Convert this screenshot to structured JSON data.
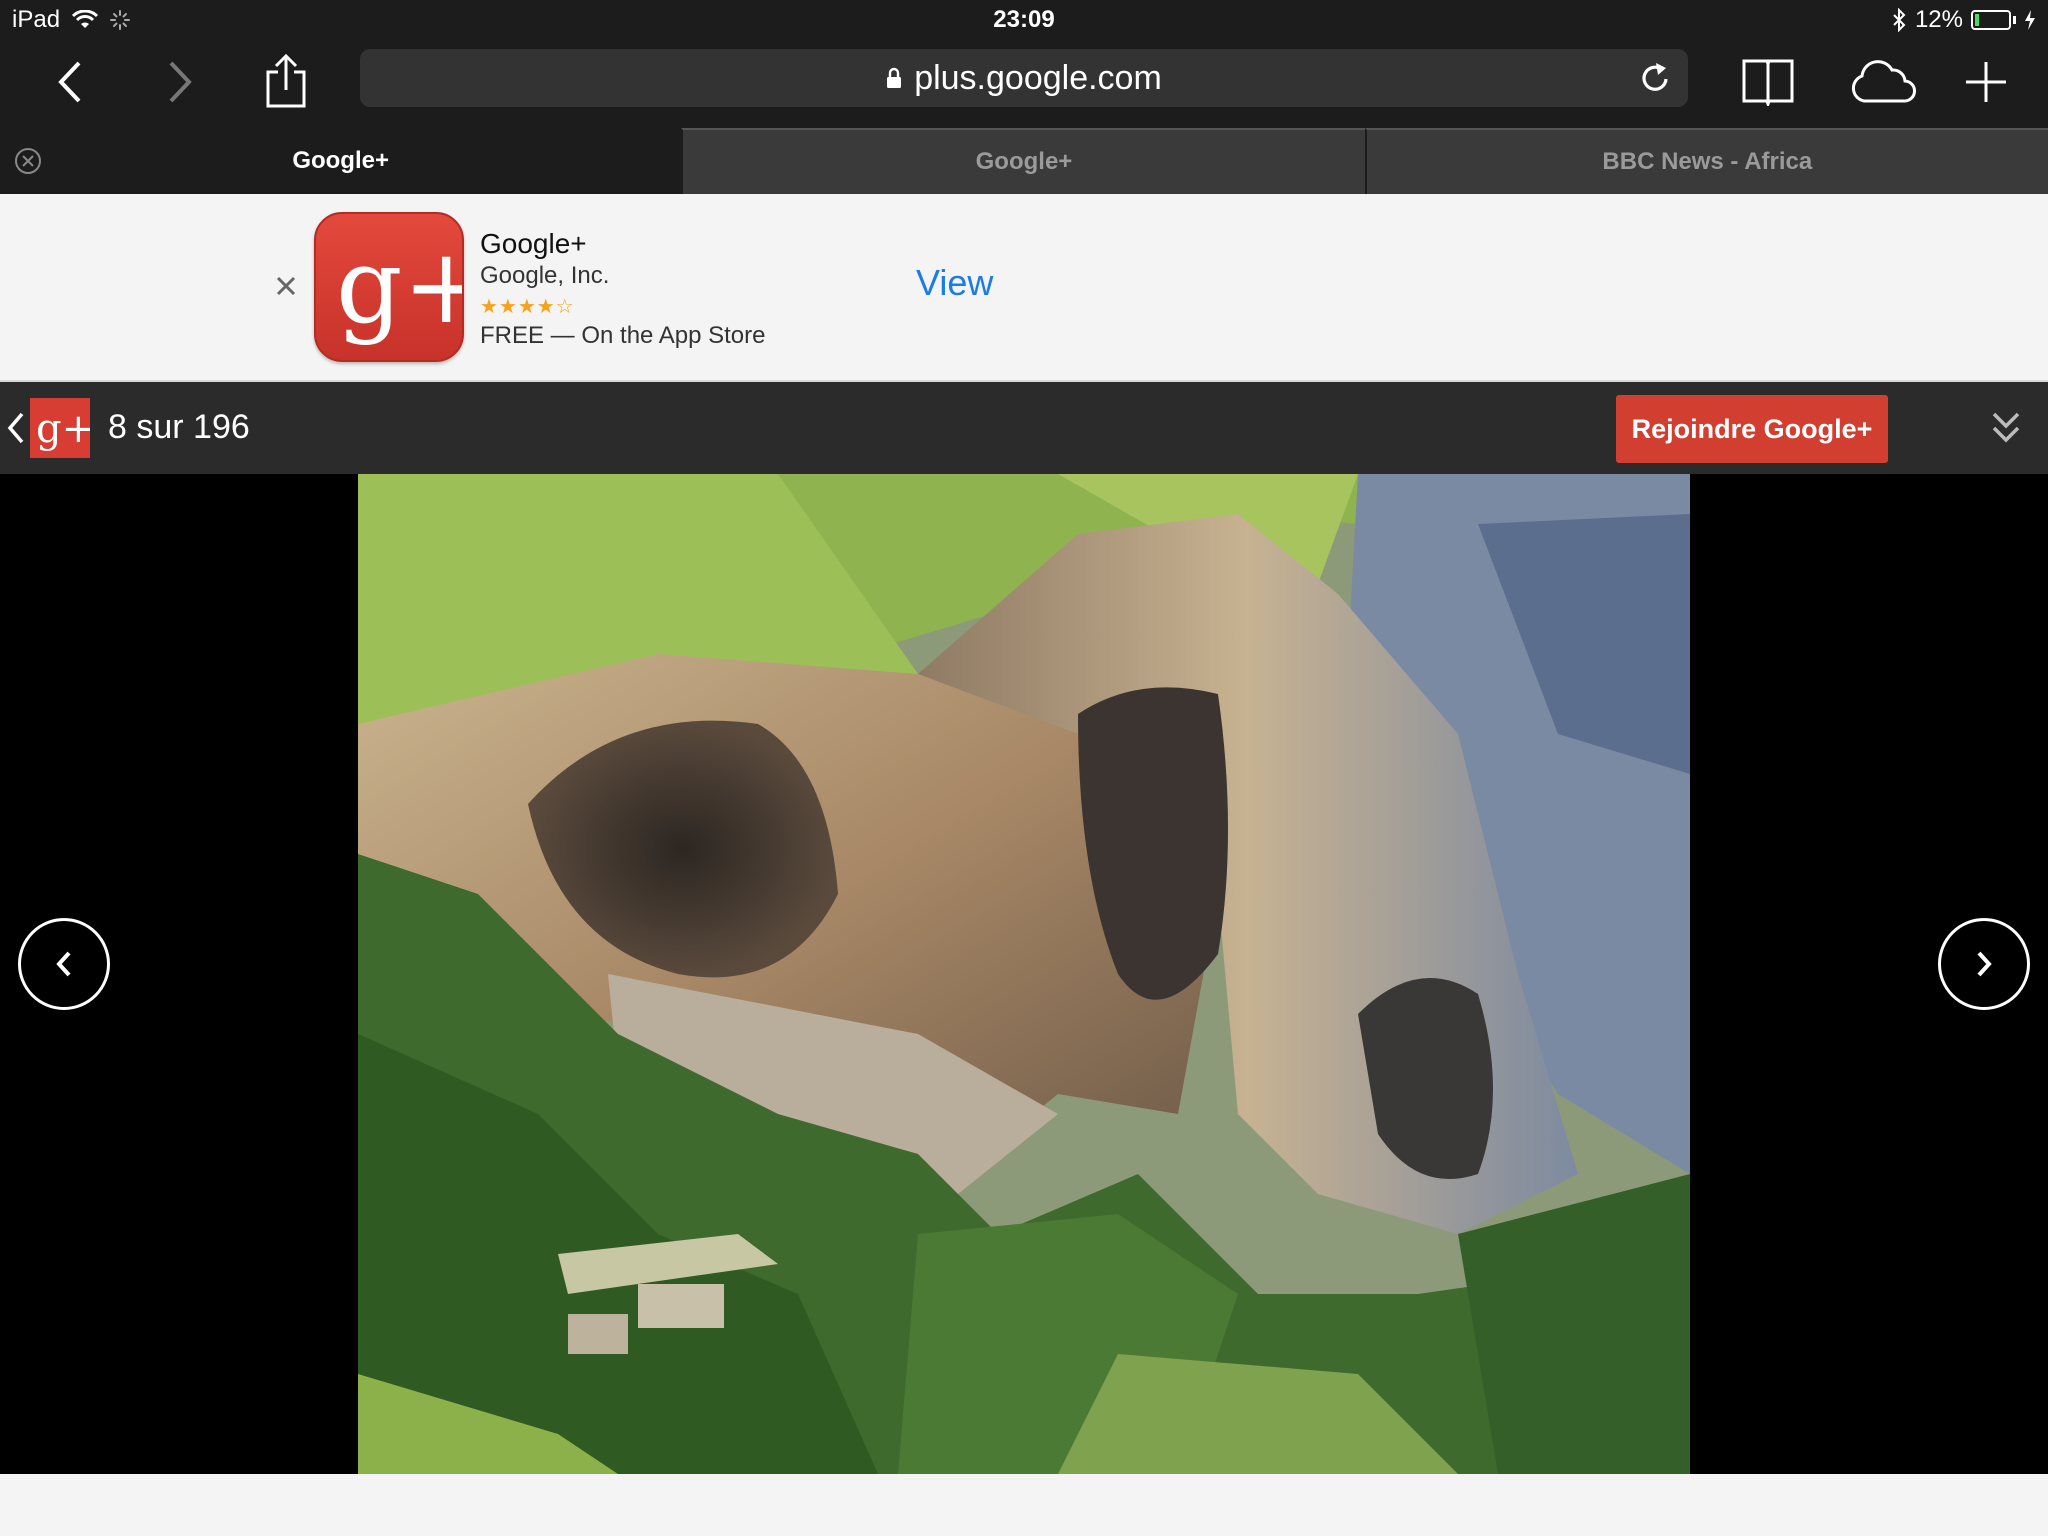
{
  "status_bar": {
    "device": "iPad",
    "time": "23:09",
    "battery": "12%",
    "battery_level": 0.12
  },
  "toolbar": {
    "url": "plus.google.com",
    "icons": [
      "chevron-left-icon",
      "chevron-right-icon",
      "share-icon",
      "lock-icon",
      "reload-icon",
      "bookmarks-icon",
      "cloud-icon",
      "plus-icon"
    ]
  },
  "tabs": [
    {
      "label": "Google+",
      "active": true
    },
    {
      "label": "Google+",
      "active": false
    },
    {
      "label": "BBC News - Africa",
      "active": false
    }
  ],
  "app_banner": {
    "app_name": "Google+",
    "developer": "Google, Inc.",
    "stars": "★★★★☆",
    "rating": 4,
    "price_line": "FREE — On the App Store",
    "view_label": "View",
    "icon_text": "g+"
  },
  "gplus_bar": {
    "logo_text": "g+",
    "counter": "8 sur 196",
    "join_label": "Rejoindre Google+"
  },
  "colors": {
    "chrome_dark": "#1c1c1c",
    "gplus_red": "#d23f31",
    "link_blue": "#1a7ce6"
  }
}
